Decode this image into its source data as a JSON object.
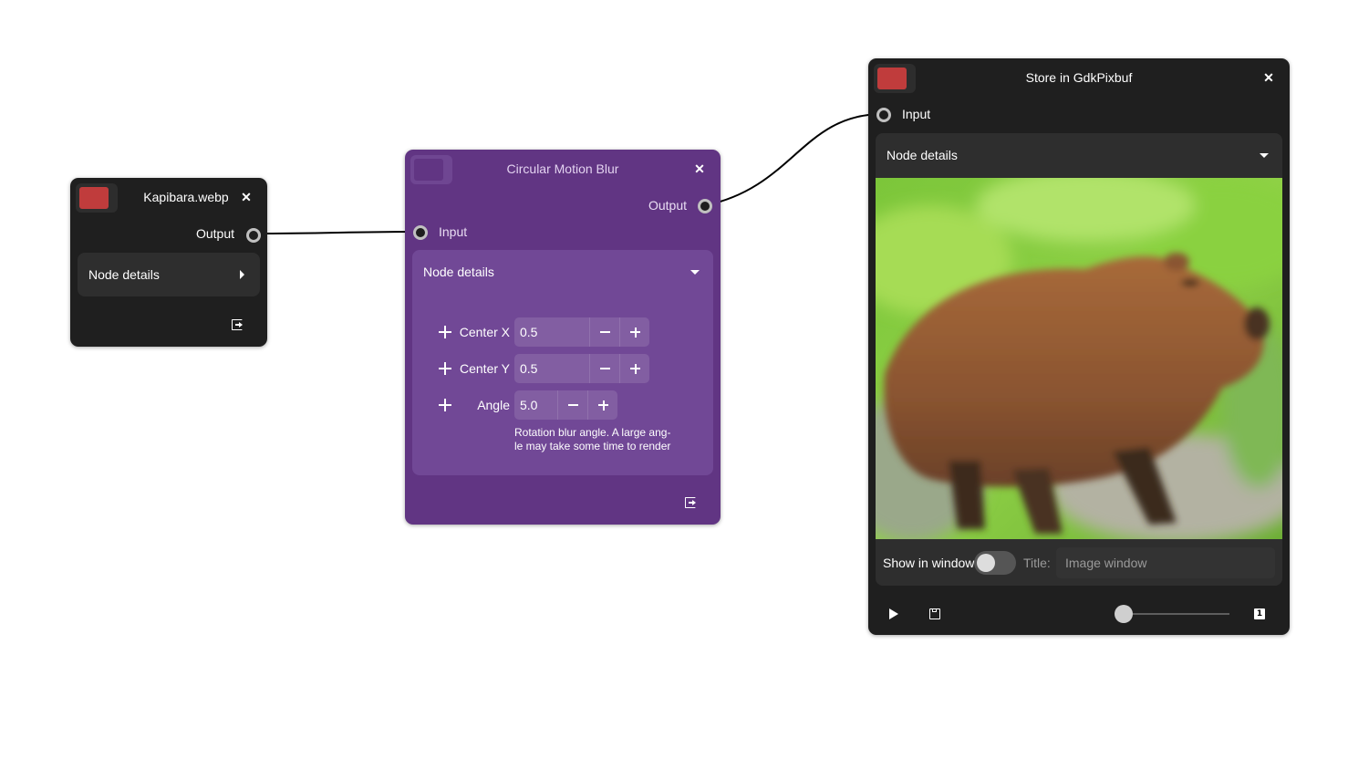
{
  "nodes": {
    "source": {
      "title": "Kapibara.webp",
      "color": "#c0392b",
      "output_label": "Output",
      "details_label": "Node details"
    },
    "blur": {
      "title": "Circular Motion Blur",
      "output_label": "Output",
      "input_label": "Input",
      "details_label": "Node details",
      "params": [
        {
          "label": "Center X",
          "value": "0.5"
        },
        {
          "label": "Center Y",
          "value": "0.5"
        },
        {
          "label": "Angle",
          "value": "5.0"
        }
      ],
      "angle_help_line1": "Rotation blur angle. A large ang-",
      "angle_help_line2": "le may take some time to render"
    },
    "sink": {
      "title": "Store in GdkPixbuf",
      "color": "#c0392b",
      "input_label": "Input",
      "details_label": "Node details",
      "show_in_window_label": "Show in window",
      "show_in_window_on": false,
      "title_label": "Title:",
      "title_placeholder": "Image window",
      "slider_value": 0
    }
  }
}
